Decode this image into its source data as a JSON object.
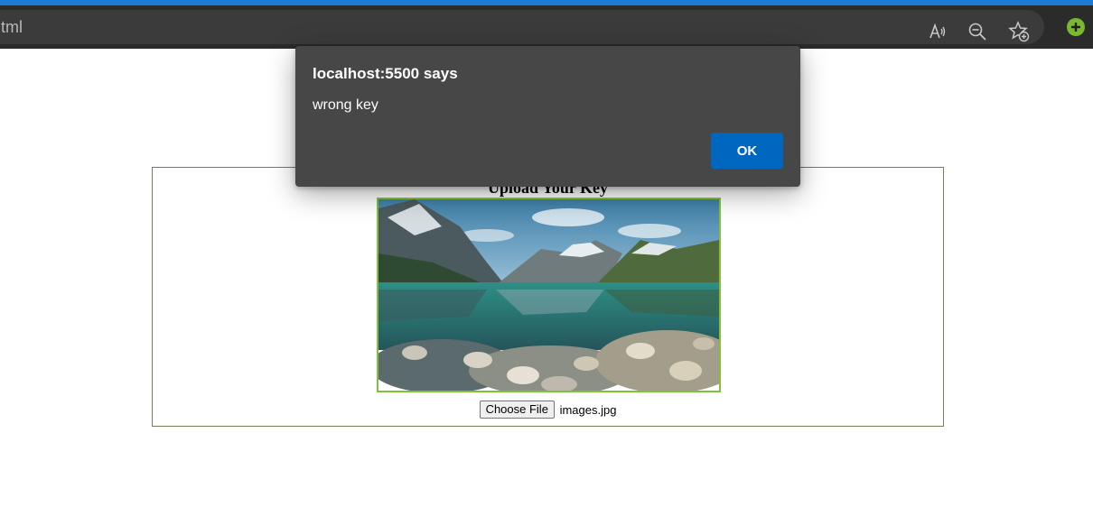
{
  "browser": {
    "url_fragment": "tml",
    "icons": [
      "read-aloud-icon",
      "zoom-out-icon",
      "add-favorite-icon",
      "extension-add-icon"
    ],
    "accent_color": "#1b7ad3"
  },
  "page": {
    "heading": "Upload Your Key",
    "image_alt": "mountain lake landscape",
    "file_input": {
      "button_label": "Choose File",
      "file_name": "images.jpg"
    }
  },
  "dialog": {
    "title": "localhost:5500 says",
    "message": "wrong key",
    "ok_label": "OK",
    "ok_color": "#0067c0"
  }
}
